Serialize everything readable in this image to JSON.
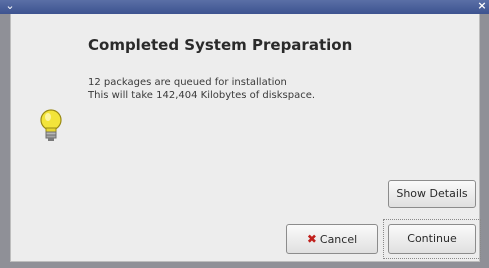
{
  "window": {
    "menu_glyph": "⌄",
    "close_glyph": "×"
  },
  "dialog": {
    "heading": "Completed System Preparation",
    "line1": "12 packages are queued for installation",
    "line2": "This will take 142,404 Kilobytes of diskspace.",
    "icon": "lightbulb-icon"
  },
  "buttons": {
    "show_details": "Show Details",
    "cancel": "Cancel",
    "cancel_icon": "✖",
    "continue": "Continue"
  },
  "colors": {
    "titlebar": "#3d5390",
    "dialog_bg": "#ededed",
    "cancel_icon": "#c0201c"
  }
}
